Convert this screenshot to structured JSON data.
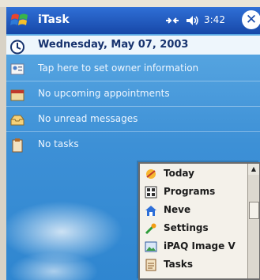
{
  "titlebar": {
    "app_title": "iTask",
    "clock": "3:42",
    "close_label": "✕"
  },
  "today": {
    "date": "Wednesday, May 07, 2003",
    "owner": "Tap here to set owner information",
    "appointments": "No upcoming appointments",
    "messages": "No unread messages",
    "tasks": "No tasks"
  },
  "start_menu": {
    "items": [
      {
        "label": "Today",
        "icon": "today-icon"
      },
      {
        "label": "Programs",
        "icon": "programs-icon"
      },
      {
        "label": "Neve",
        "icon": "house-icon"
      },
      {
        "label": "Settings",
        "icon": "settings-icon"
      },
      {
        "label": "iPAQ Image V",
        "icon": "image-icon"
      },
      {
        "label": "Tasks",
        "icon": "tasks-icon"
      }
    ],
    "scroll_up": "▲"
  },
  "colors": {
    "titlebar": "#1f5dc0",
    "sky": "#3d90d6",
    "menu_bg": "#f4f1ea"
  }
}
